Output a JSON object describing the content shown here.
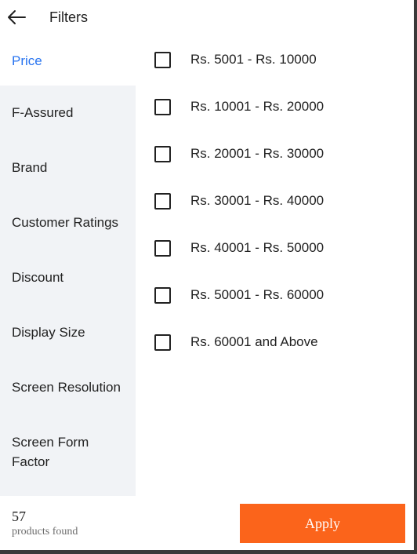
{
  "header": {
    "back_icon": "arrow-left-icon",
    "title": "Filters"
  },
  "sidebar": {
    "items": [
      {
        "label": "Price",
        "active": true
      },
      {
        "label": "F-Assured",
        "active": false
      },
      {
        "label": "Brand",
        "active": false
      },
      {
        "label": "Customer Ratings",
        "active": false
      },
      {
        "label": "Discount",
        "active": false
      },
      {
        "label": "Display Size",
        "active": false
      },
      {
        "label": "Screen Resolution",
        "active": false
      },
      {
        "label": "Screen Form Factor",
        "active": false
      }
    ]
  },
  "options": [
    {
      "label": "Rs. 5001 - Rs. 10000",
      "checked": false
    },
    {
      "label": "Rs. 10001 - Rs. 20000",
      "checked": false
    },
    {
      "label": "Rs. 20001 - Rs. 30000",
      "checked": false
    },
    {
      "label": "Rs. 30001 - Rs. 40000",
      "checked": false
    },
    {
      "label": "Rs. 40001 - Rs. 50000",
      "checked": false
    },
    {
      "label": "Rs. 50001 - Rs. 60000",
      "checked": false
    },
    {
      "label": "Rs. 60001 and Above",
      "checked": false
    }
  ],
  "footer": {
    "count": "57",
    "count_label": "products found",
    "apply_label": "Apply"
  },
  "colors": {
    "accent": "#2874f0",
    "apply_button": "#fb641b",
    "sidebar_bg": "#f1f3f6"
  }
}
